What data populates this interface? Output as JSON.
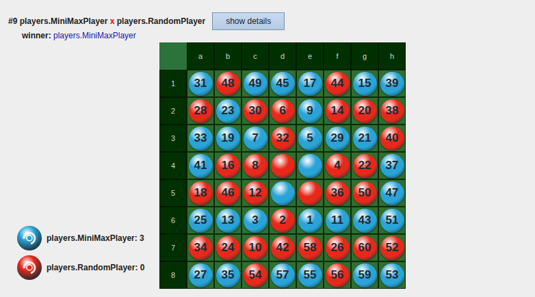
{
  "match": {
    "number": "#9",
    "player1": "players.MiniMaxPlayer",
    "separator": "x",
    "player2": "players.RandomPlayer"
  },
  "button": "show details",
  "winner": {
    "label": "winner:",
    "name": "players.MiniMaxPlayer"
  },
  "board": {
    "columns": [
      "a",
      "b",
      "c",
      "d",
      "e",
      "f",
      "g",
      "h"
    ],
    "rows": [
      {
        "label": "1",
        "cells": [
          {
            "color": "#2aa3d6",
            "number": "31"
          },
          {
            "color": "#e8281a",
            "number": "48"
          },
          {
            "color": "#2aa3d6",
            "number": "49"
          },
          {
            "color": "#2aa3d6",
            "number": "45"
          },
          {
            "color": "#2aa3d6",
            "number": "17"
          },
          {
            "color": "#e8281a",
            "number": "44"
          },
          {
            "color": "#2aa3d6",
            "number": "15"
          },
          {
            "color": "#2aa3d6",
            "number": "39"
          }
        ]
      },
      {
        "label": "2",
        "cells": [
          {
            "color": "#e8281a",
            "number": "28"
          },
          {
            "color": "#2aa3d6",
            "number": "23"
          },
          {
            "color": "#e8281a",
            "number": "30"
          },
          {
            "color": "#e8281a",
            "number": "6"
          },
          {
            "color": "#2aa3d6",
            "number": "9"
          },
          {
            "color": "#e8281a",
            "number": "14"
          },
          {
            "color": "#e8281a",
            "number": "20"
          },
          {
            "color": "#e8281a",
            "number": "38"
          }
        ]
      },
      {
        "label": "3",
        "cells": [
          {
            "color": "#2aa3d6",
            "number": "33"
          },
          {
            "color": "#2aa3d6",
            "number": "19"
          },
          {
            "color": "#2aa3d6",
            "number": "7"
          },
          {
            "color": "#e8281a",
            "number": "32"
          },
          {
            "color": "#2aa3d6",
            "number": "5"
          },
          {
            "color": "#2aa3d6",
            "number": "29"
          },
          {
            "color": "#2aa3d6",
            "number": "21"
          },
          {
            "color": "#e8281a",
            "number": "40"
          }
        ]
      },
      {
        "label": "4",
        "cells": [
          {
            "color": "#2aa3d6",
            "number": "41"
          },
          {
            "color": "#e8281a",
            "number": "16"
          },
          {
            "color": "#e8281a",
            "number": "8"
          },
          {
            "color": "#e8281a",
            "number": ""
          },
          {
            "color": "#2aa3d6",
            "number": ""
          },
          {
            "color": "#e8281a",
            "number": "4"
          },
          {
            "color": "#e8281a",
            "number": "22"
          },
          {
            "color": "#2aa3d6",
            "number": "37"
          }
        ]
      },
      {
        "label": "5",
        "cells": [
          {
            "color": "#e8281a",
            "number": "18"
          },
          {
            "color": "#e8281a",
            "number": "46"
          },
          {
            "color": "#e8281a",
            "number": "12"
          },
          {
            "color": "#2aa3d6",
            "number": ""
          },
          {
            "color": "#e8281a",
            "number": ""
          },
          {
            "color": "#e8281a",
            "number": "36"
          },
          {
            "color": "#e8281a",
            "number": "50"
          },
          {
            "color": "#2aa3d6",
            "number": "47"
          }
        ]
      },
      {
        "label": "6",
        "cells": [
          {
            "color": "#2aa3d6",
            "number": "25"
          },
          {
            "color": "#2aa3d6",
            "number": "13"
          },
          {
            "color": "#2aa3d6",
            "number": "3"
          },
          {
            "color": "#e8281a",
            "number": "2"
          },
          {
            "color": "#2aa3d6",
            "number": "1"
          },
          {
            "color": "#2aa3d6",
            "number": "11"
          },
          {
            "color": "#2aa3d6",
            "number": "43"
          },
          {
            "color": "#2aa3d6",
            "number": "51"
          }
        ]
      },
      {
        "label": "7",
        "cells": [
          {
            "color": "#e8281a",
            "number": "34"
          },
          {
            "color": "#e8281a",
            "number": "24"
          },
          {
            "color": "#e8281a",
            "number": "10"
          },
          {
            "color": "#e8281a",
            "number": "42"
          },
          {
            "color": "#e8281a",
            "number": "58"
          },
          {
            "color": "#e8281a",
            "number": "26"
          },
          {
            "color": "#e8281a",
            "number": "60"
          },
          {
            "color": "#e8281a",
            "number": "52"
          }
        ]
      },
      {
        "label": "8",
        "cells": [
          {
            "color": "#2aa3d6",
            "number": "27"
          },
          {
            "color": "#2aa3d6",
            "number": "35"
          },
          {
            "color": "#e8281a",
            "number": "54"
          },
          {
            "color": "#2aa3d6",
            "number": "57"
          },
          {
            "color": "#2aa3d6",
            "number": "55"
          },
          {
            "color": "#e8281a",
            "number": "56"
          },
          {
            "color": "#2aa3d6",
            "number": "59"
          },
          {
            "color": "#2aa3d6",
            "number": "53"
          }
        ]
      }
    ]
  },
  "legend": [
    {
      "label": "players.MiniMaxPlayer: 3",
      "color": "#2aa3d6"
    },
    {
      "label": "players.RandomPlayer: 0",
      "color": "#e8281a"
    }
  ]
}
